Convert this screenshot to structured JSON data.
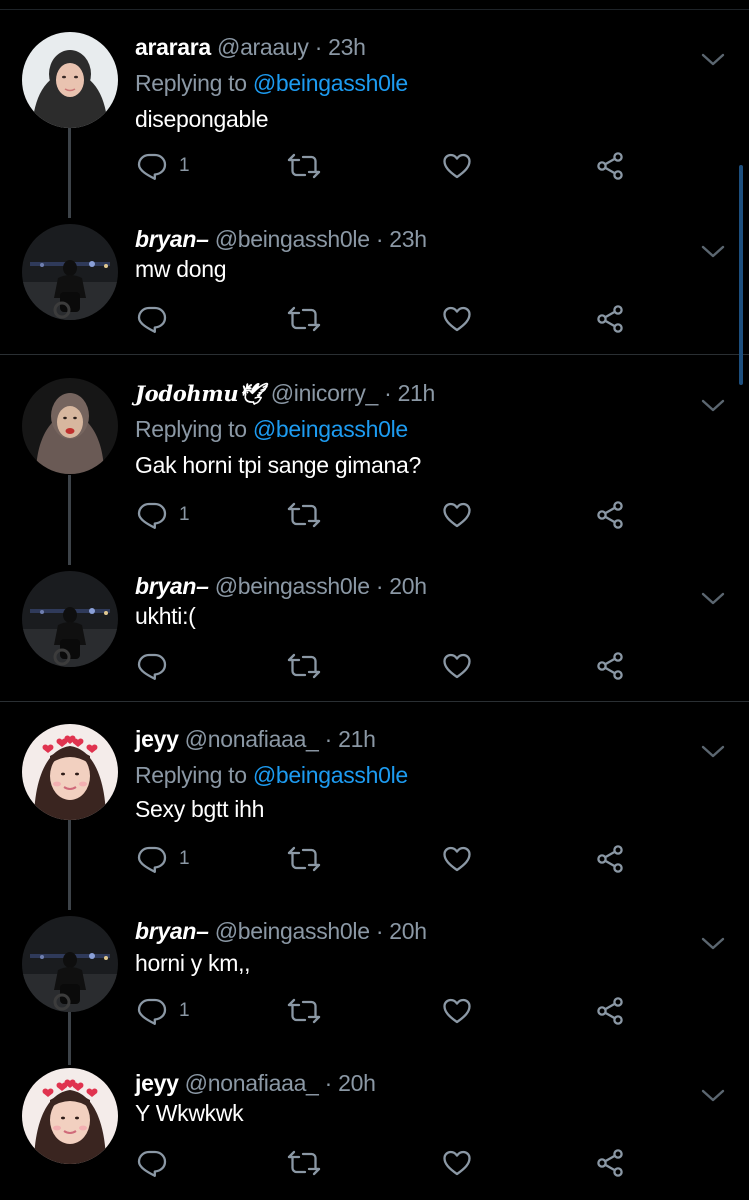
{
  "tweets": [
    {
      "name": "ararara",
      "handle": "@araauy",
      "time": "23h",
      "reply_label": "Replying to",
      "reply_to": "@beingassh0le",
      "text": "disepongable",
      "reply_count": "1",
      "avatar": "girl-hijab-avatar"
    },
    {
      "name": "bryan–",
      "handle": "@beingassh0le",
      "time": "23h",
      "reply_label": "",
      "reply_to": "",
      "text": "mw dong",
      "reply_count": "",
      "avatar": "night-motorcycle-avatar"
    },
    {
      "name": "Jodohmu🕊",
      "handle": "@inicorry_",
      "time": "21h",
      "reply_label": "Replying to",
      "reply_to": "@beingassh0le",
      "text": "Gak horni tpi sange gimana?",
      "reply_count": "1",
      "avatar": "girl-hijab-red-lips-avatar"
    },
    {
      "name": "bryan–",
      "handle": "@beingassh0le",
      "time": "20h",
      "reply_label": "",
      "reply_to": "",
      "text": "ukhti:(",
      "reply_count": "",
      "avatar": "night-motorcycle-avatar"
    },
    {
      "name": "jeyy",
      "handle": "@nonafiaaa_",
      "time": "21h",
      "reply_label": "Replying to",
      "reply_to": "@beingassh0le",
      "text": "Sexy bgtt ihh",
      "reply_count": "1",
      "avatar": "girl-heart-filter-avatar"
    },
    {
      "name": "bryan–",
      "handle": "@beingassh0le",
      "time": "20h",
      "reply_label": "",
      "reply_to": "",
      "text": "horni y km,,",
      "reply_count": "1",
      "avatar": "night-motorcycle-avatar"
    },
    {
      "name": "jeyy",
      "handle": "@nonafiaaa_",
      "time": "20h",
      "reply_label": "",
      "reply_to": "",
      "text": "Y Wkwkwk",
      "reply_count": "",
      "avatar": "girl-heart-filter-avatar"
    }
  ],
  "colors": {
    "background": "#000000",
    "text": "#ffffff",
    "secondary": "#8b98a5",
    "link": "#1d9bf0",
    "thread_line": "#3d4349",
    "scrollbar": "#1d4f7e"
  },
  "icons": {
    "reply": "reply-icon",
    "retweet": "retweet-icon",
    "like": "like-icon",
    "share": "share-icon",
    "menu": "chevron-down-icon"
  }
}
